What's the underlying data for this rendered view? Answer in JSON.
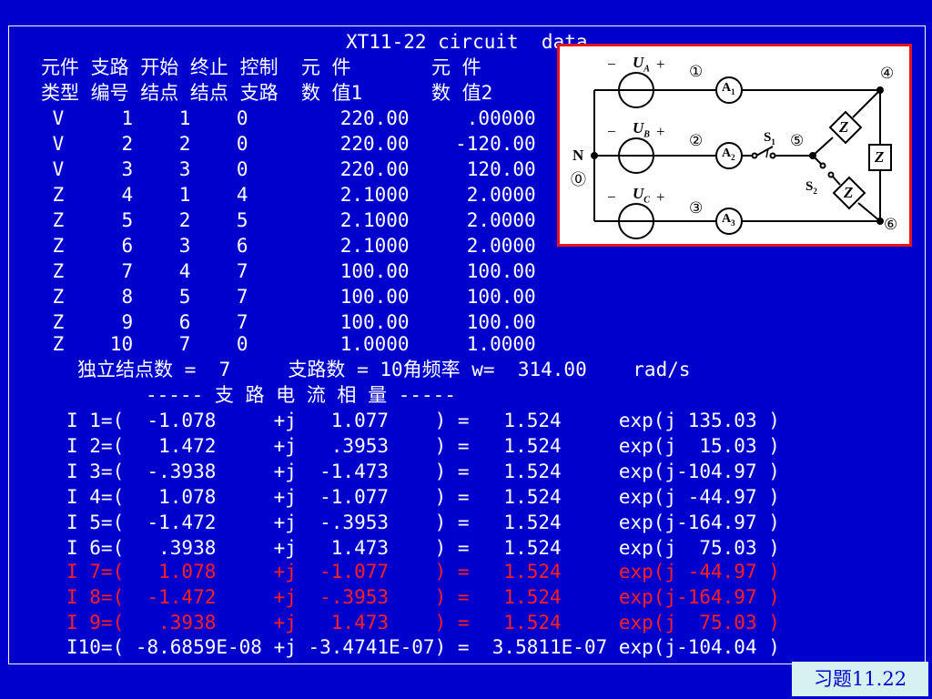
{
  "title": "XT11-22 circuit  data",
  "header": {
    "line1": "元件 支路 开始 终止 控制  元 件       元 件",
    "line2": "类型 编号 结点 结点 支路  数 值1      数 值2"
  },
  "rows": [
    " V     1    1    0        220.00     .00000",
    " V     2    2    0        220.00    -120.00",
    " V     3    3    0        220.00     120.00",
    " Z     4    1    4        2.1000     2.0000",
    " Z     5    2    5        2.1000     2.0000",
    " Z     6    3    6        2.1000     2.0000",
    " Z     7    4    7        100.00     100.00",
    " Z     8    5    7        100.00     100.00",
    " Z     9    6    7        100.00     100.00",
    " Z    10    7    0        1.0000     1.0000"
  ],
  "summary": "独立结点数 =  7     支路数 = 10角频率 w=  314.00    rad/s",
  "section_title": "----- 支 路 电 流 相 量 -----",
  "currents": [
    {
      "text": "I 1=(  -1.078     +j   1.077    ) =   1.524     exp(j 135.03 )",
      "highlight": false
    },
    {
      "text": "I 2=(   1.472     +j   .3953    ) =   1.524     exp(j  15.03 )",
      "highlight": false
    },
    {
      "text": "I 3=(  -.3938     +j  -1.473    ) =   1.524     exp(j-104.97 )",
      "highlight": false
    },
    {
      "text": "I 4=(   1.078     +j  -1.077    ) =   1.524     exp(j -44.97 )",
      "highlight": false
    },
    {
      "text": "I 5=(  -1.472     +j  -.3953    ) =   1.524     exp(j-164.97 )",
      "highlight": false
    },
    {
      "text": "I 6=(   .3938     +j   1.473    ) =   1.524     exp(j  75.03 )",
      "highlight": false
    },
    {
      "text": "I 7=(   1.078     +j  -1.077    ) =   1.524     exp(j -44.97 )",
      "highlight": true
    },
    {
      "text": "I 8=(  -1.472     +j  -.3953    ) =   1.524     exp(j-164.97 )",
      "highlight": true
    },
    {
      "text": "I 9=(   .3938     +j   1.473    ) =   1.524     exp(j  75.03 )",
      "highlight": true
    },
    {
      "text": "I10=( -8.6859E-08 +j -3.4741E-07) =  3.5811E-07 exp(j-104.04 )",
      "highlight": false
    }
  ],
  "diagram": {
    "labels": {
      "ua": "U",
      "ua_sub": "A",
      "ub": "U",
      "ub_sub": "B",
      "uc": "U",
      "uc_sub": "C",
      "minus": "−",
      "plus": "+",
      "n1": "①",
      "n2": "②",
      "n3": "③",
      "n4": "④",
      "n5": "⑤",
      "n6": "⑥",
      "n0": "⓪",
      "N": "N",
      "a1": "A",
      "a1_sub": "1",
      "a2": "A",
      "a2_sub": "2",
      "a3": "A",
      "a3_sub": "3",
      "s1": "S",
      "s1_sub": "1",
      "s2": "S",
      "s2_sub": "2",
      "z": "Z"
    }
  },
  "badge": "习题11.22",
  "colors": {
    "background": "#0000cc",
    "text": "#ffffff",
    "highlight": "#ff2020",
    "diagram_border": "#e8141c",
    "badge_bg": "#d6f1f1"
  }
}
